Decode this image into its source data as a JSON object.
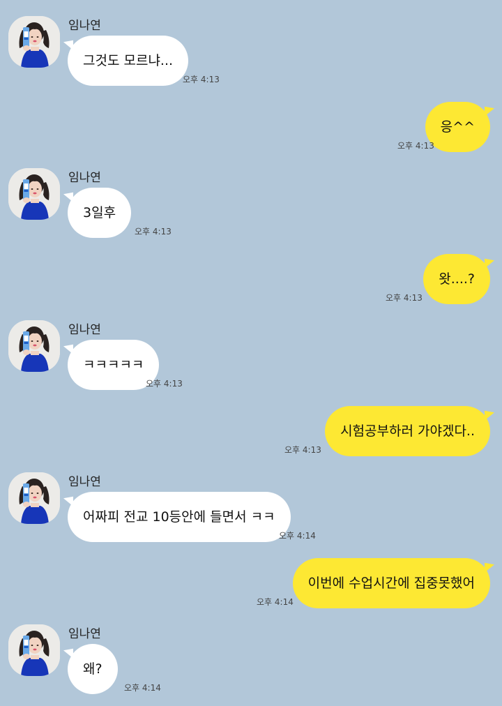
{
  "contact": {
    "name": "임나연",
    "avatar_icon": "profile-photo"
  },
  "colors": {
    "background": "#b2c7d9",
    "incoming": "#ffffff",
    "outgoing": "#fde833"
  },
  "messages": [
    {
      "from": "them",
      "text": "그것도 모르냐...",
      "time": "오후 4:13"
    },
    {
      "from": "me",
      "text": "응^^",
      "time": "오후 4:13"
    },
    {
      "from": "them",
      "text": "3일후",
      "time": "오후 4:13"
    },
    {
      "from": "me",
      "text": "왓....?",
      "time": "오후 4:13"
    },
    {
      "from": "them",
      "text": "ㅋㅋㅋㅋㅋ",
      "time": "오후 4:13"
    },
    {
      "from": "me",
      "text": "시험공부하러 가야겠다..",
      "time": "오후 4:13"
    },
    {
      "from": "them",
      "text": "어짜피 전교 10등안에 들면서 ㅋㅋ",
      "time": "오후 4:14"
    },
    {
      "from": "me",
      "text": "이번에 수업시간에 집중못했어",
      "time": "오후 4:14"
    },
    {
      "from": "them",
      "text": "왜?",
      "time": "오후 4:14"
    }
  ]
}
